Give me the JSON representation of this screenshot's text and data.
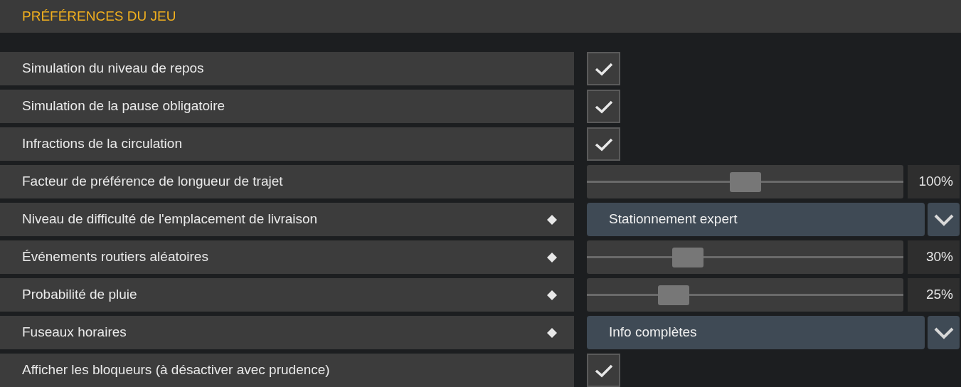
{
  "header": {
    "title": "PRÉFÉRENCES DU JEU"
  },
  "rows": [
    {
      "kind": "checkbox",
      "label": "Simulation du niveau de repos",
      "flagged": false,
      "checked": true
    },
    {
      "kind": "checkbox",
      "label": "Simulation de la pause obligatoire",
      "flagged": false,
      "checked": true
    },
    {
      "kind": "checkbox",
      "label": "Infractions de la circulation",
      "flagged": false,
      "checked": true
    },
    {
      "kind": "slider",
      "label": "Facteur de préférence de longueur de trajet",
      "flagged": false,
      "level": 0.5,
      "reading": "100%"
    },
    {
      "kind": "dropdown",
      "label": "Niveau de difficulté de l'emplacement de livraison",
      "flagged": true,
      "value": "Stationnement expert"
    },
    {
      "kind": "slider",
      "label": "Événements routiers aléatoires",
      "flagged": true,
      "level": 0.3,
      "reading": "30%"
    },
    {
      "kind": "slider",
      "label": "Probabilité de pluie",
      "flagged": true,
      "level": 0.25,
      "reading": "25%"
    },
    {
      "kind": "dropdown",
      "label": "Fuseaux horaires",
      "flagged": true,
      "value": "Info complètes"
    },
    {
      "kind": "checkbox",
      "label": "Afficher les bloqueurs (à désactiver avec prudence)",
      "flagged": false,
      "checked": true
    }
  ]
}
